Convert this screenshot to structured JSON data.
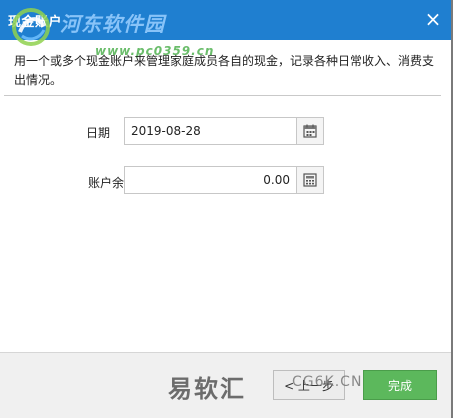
{
  "window": {
    "title": "现金账户",
    "close_glyph": "×"
  },
  "watermark": {
    "site_name": "河东软件园",
    "site_url": "www.pc0359.cn",
    "footer_text": "易软汇",
    "footer_url": "CG6K.CN"
  },
  "description": "用一个或多个现金账户来管理家庭成员各自的现金，记录各种日常收入、消费支出情况。",
  "form": {
    "date_label": "日期",
    "date_value": "2019-08-28",
    "balance_label": "账户余额",
    "balance_value": "0.00"
  },
  "buttons": {
    "prev_label": "< 上一步",
    "finish_label": "完成"
  },
  "icons": {
    "date_picker": "calendar-icon",
    "calculator": "calculator-icon",
    "close": "close-icon",
    "logo": "logo-icon"
  },
  "colors": {
    "titlebar": "#1f7fd0",
    "finish_button": "#5cb85c"
  }
}
